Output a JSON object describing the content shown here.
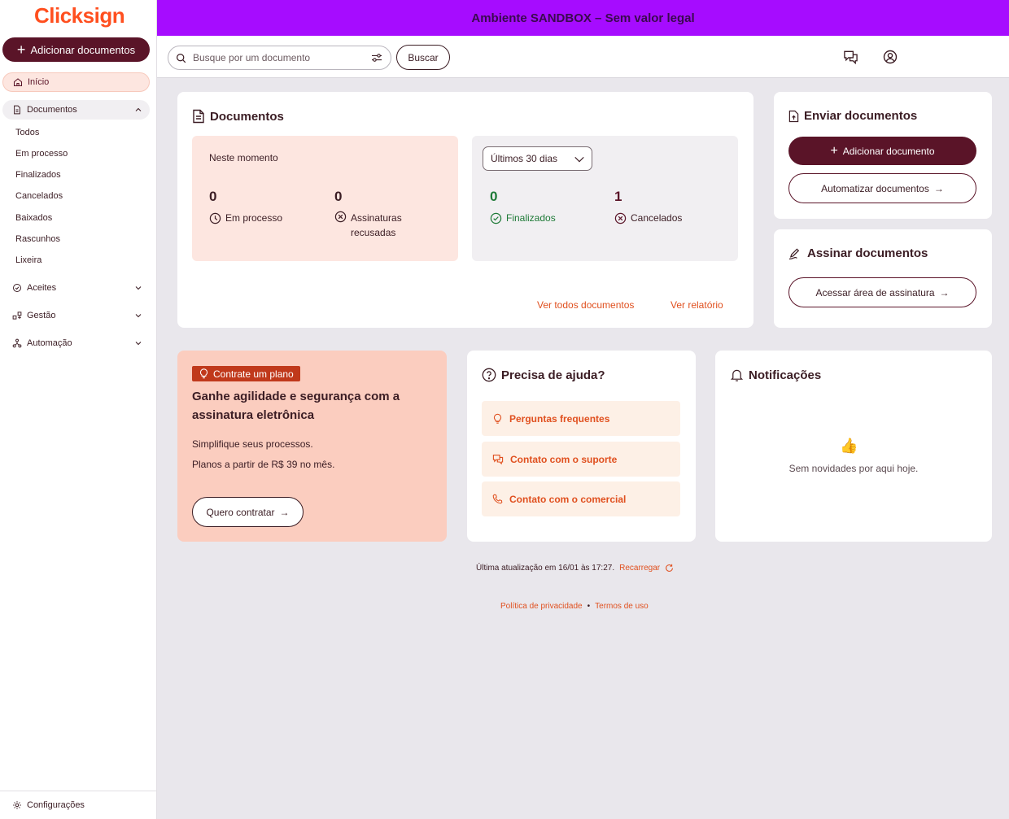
{
  "brand": {
    "logo": "Clicksign",
    "accent": "#ff4f1f",
    "primary": "#5a1428",
    "banner_color": "#a60cff"
  },
  "banner": {
    "text": "Ambiente SANDBOX – Sem valor legal"
  },
  "sidebar": {
    "add_button": "Adicionar documentos",
    "home": "Início",
    "documents": "Documentos",
    "document_items": [
      "Todos",
      "Em processo",
      "Finalizados",
      "Cancelados",
      "Baixados",
      "Rascunhos",
      "Lixeira"
    ],
    "aceites": "Aceites",
    "gestao": "Gestão",
    "automacao": "Automação",
    "settings": "Configurações"
  },
  "header": {
    "search_placeholder": "Busque por um documento",
    "search_button": "Buscar"
  },
  "documents_card": {
    "title": "Documentos",
    "now_label": "Neste momento",
    "in_process_count": "0",
    "in_process_label": "Em processo",
    "refused_count": "0",
    "refused_label_1": "Assinaturas",
    "refused_label_2": "recusadas",
    "period_select": "Últimos 30 dias",
    "finished_count": "0",
    "finished_label": "Finalizados",
    "canceled_count": "1",
    "canceled_label": "Cancelados",
    "link_all": "Ver todos documentos",
    "link_report": "Ver relatório"
  },
  "send_card": {
    "title": "Enviar documentos",
    "add_button": "Adicionar documento",
    "automate_button": "Automatizar documentos"
  },
  "sign_card": {
    "title": "Assinar documentos",
    "access_button": "Acessar área de assinatura"
  },
  "plan_card": {
    "badge": "Contrate um plano",
    "heading": "Ganhe agilidade e segurança com a assinatura eletrônica",
    "line1": "Simplifique seus processos.",
    "line2": "Planos a partir de R$ 39 no mês.",
    "button": "Quero contratar"
  },
  "help_card": {
    "title": "Precisa de ajuda?",
    "items": [
      "Perguntas frequentes",
      "Contato com o suporte",
      "Contato com o comercial"
    ]
  },
  "notifications_card": {
    "title": "Notificações",
    "empty_text": "Sem novidades por aqui hoje."
  },
  "footer": {
    "last_update": "Última atualização em 16/01 às 17:27.",
    "reload": "Recarregar",
    "privacy": "Política de privacidade",
    "separator": "•",
    "terms": "Termos de uso"
  }
}
